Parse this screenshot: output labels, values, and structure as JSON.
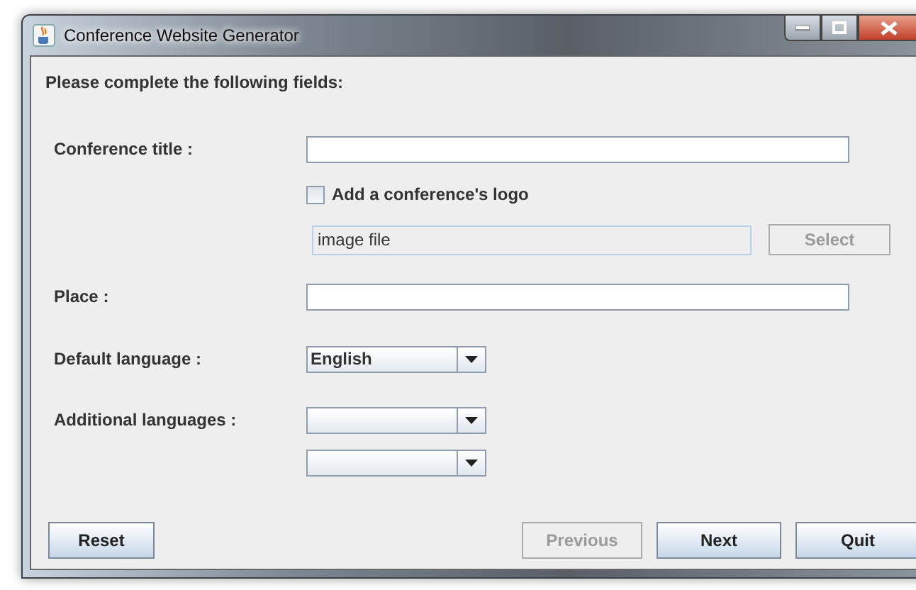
{
  "window": {
    "title": "Conference Website Generator"
  },
  "instructions": "Please complete the following fields:",
  "conference_title": {
    "label": "Conference title :"
  },
  "logo": {
    "label": "Add a conference's logo",
    "checked": false
  },
  "image_file": {
    "value": "image file",
    "disabled": true
  },
  "select_button": {
    "label": "Select",
    "disabled": true
  },
  "place": {
    "label": "Place :"
  },
  "default_language": {
    "label": "Default language :",
    "value": "English"
  },
  "additional_languages": {
    "label": "Additional languages :",
    "combos": [
      {
        "kind": "combo"
      },
      {
        "kind": "combo"
      }
    ]
  },
  "buttons": [
    {
      "label": "Reset",
      "disabled": false,
      "kind": "left"
    },
    {
      "label": "Previous",
      "disabled": true,
      "kind": "right"
    },
    {
      "label": "Next",
      "disabled": false,
      "kind": "right"
    },
    {
      "label": "Quit",
      "disabled": false,
      "kind": "right"
    }
  ]
}
